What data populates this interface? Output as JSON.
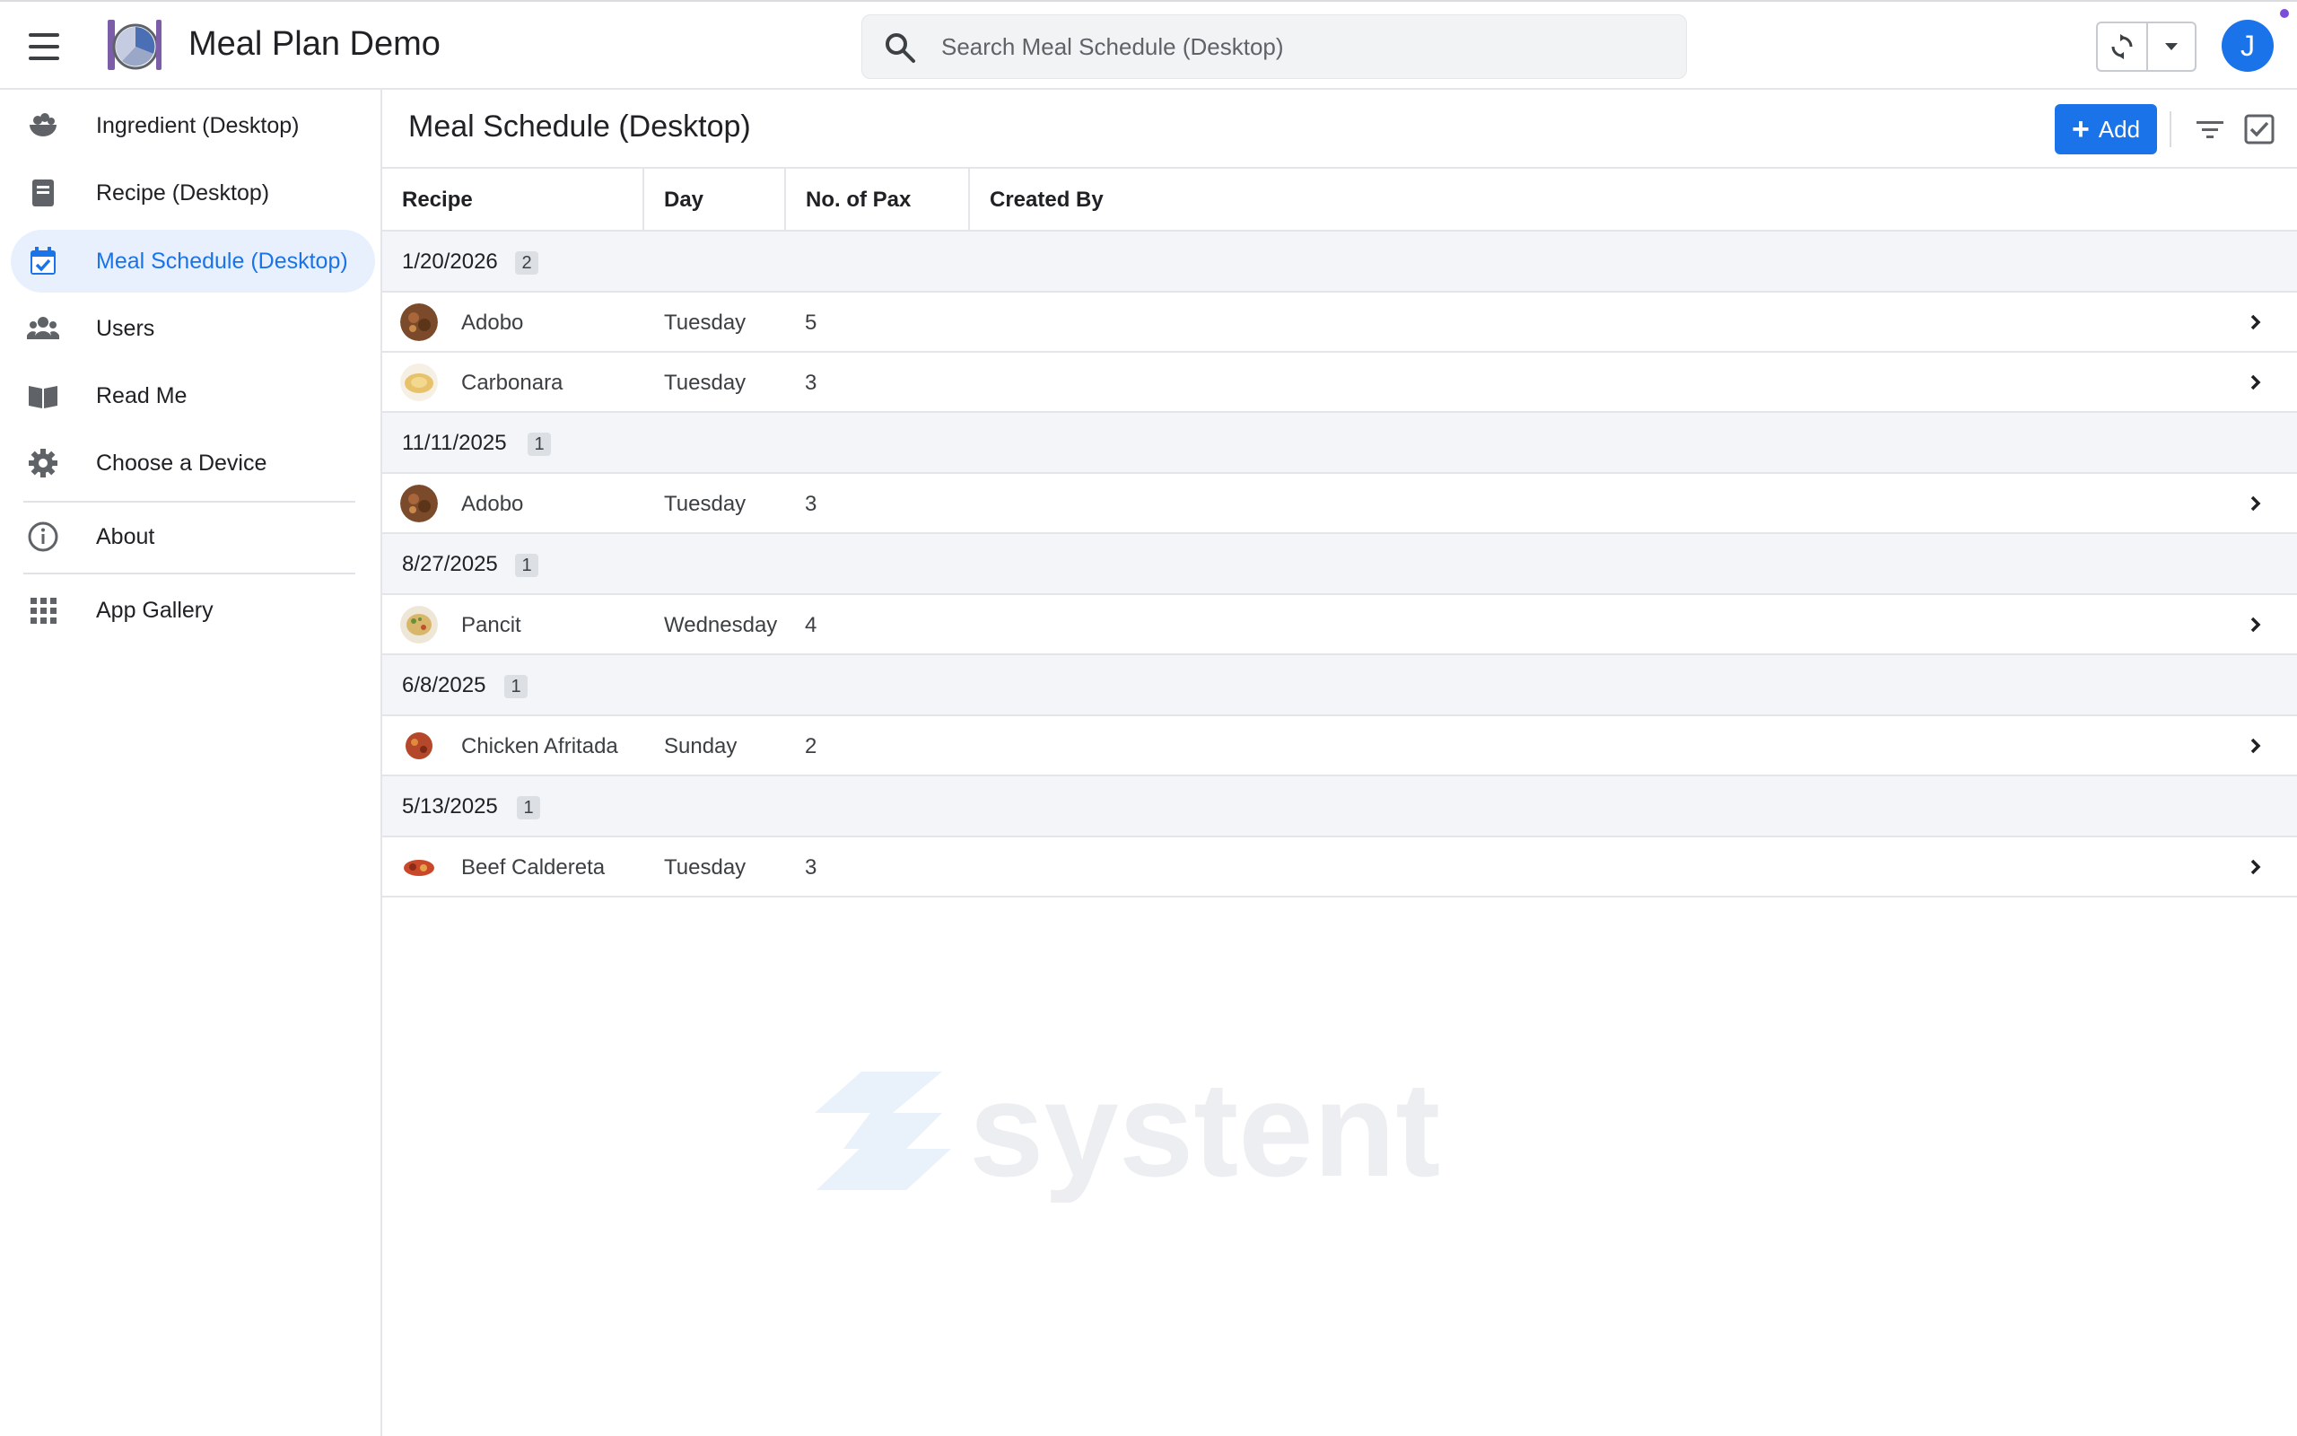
{
  "app": {
    "title": "Meal Plan Demo"
  },
  "search": {
    "placeholder": "Search Meal Schedule (Desktop)"
  },
  "user": {
    "avatar_initial": "J"
  },
  "sidebar": {
    "items": [
      {
        "label": "Ingredient (Desktop)",
        "icon": "salad-bowl-icon"
      },
      {
        "label": "Recipe (Desktop)",
        "icon": "book-icon"
      },
      {
        "label": "Meal Schedule (Desktop)",
        "icon": "calendar-check-icon",
        "active": true
      },
      {
        "label": "Users",
        "icon": "users-icon"
      },
      {
        "label": "Read Me",
        "icon": "open-book-icon"
      },
      {
        "label": "Choose a Device",
        "icon": "gear-icon"
      },
      {
        "label": "About",
        "icon": "info-icon"
      },
      {
        "label": "App Gallery",
        "icon": "grid-icon"
      }
    ]
  },
  "main": {
    "title": "Meal Schedule (Desktop)",
    "add_label": "Add"
  },
  "table": {
    "columns": [
      "Recipe",
      "Day",
      "No. of Pax",
      "Created By"
    ],
    "groups": [
      {
        "date": "1/20/2026",
        "count": "2",
        "rows": [
          {
            "recipe": "Adobo",
            "day": "Tuesday",
            "pax": "5",
            "created_by": ""
          },
          {
            "recipe": "Carbonara",
            "day": "Tuesday",
            "pax": "3",
            "created_by": ""
          }
        ]
      },
      {
        "date": "11/11/2025",
        "count": "1",
        "rows": [
          {
            "recipe": "Adobo",
            "day": "Tuesday",
            "pax": "3",
            "created_by": ""
          }
        ]
      },
      {
        "date": "8/27/2025",
        "count": "1",
        "rows": [
          {
            "recipe": "Pancit",
            "day": "Wednesday",
            "pax": "4",
            "created_by": ""
          }
        ]
      },
      {
        "date": "6/8/2025",
        "count": "1",
        "rows": [
          {
            "recipe": "Chicken Afritada",
            "day": "Sunday",
            "pax": "2",
            "created_by": ""
          }
        ]
      },
      {
        "date": "5/13/2025",
        "count": "1",
        "rows": [
          {
            "recipe": "Beef Caldereta",
            "day": "Tuesday",
            "pax": "3",
            "created_by": ""
          }
        ]
      }
    ]
  },
  "watermark": {
    "text": "systent"
  },
  "colors": {
    "accent": "#1a73e8",
    "active_bg": "#e8f0fe",
    "group_bg": "#f3f5f8"
  }
}
